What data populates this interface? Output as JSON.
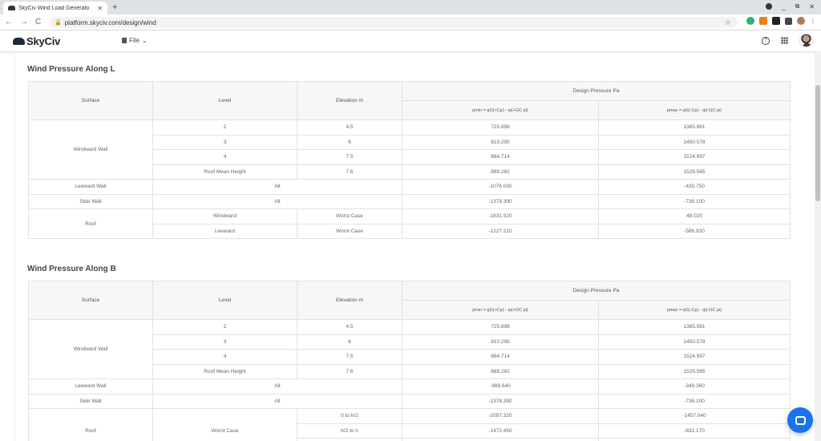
{
  "browser": {
    "tab_title": "SkyCiv Wind Load Generato",
    "tab_close": "✕",
    "new_tab": "+",
    "url": "platform.skyciv.com/design/wind",
    "win_minimize": "_",
    "win_restore": "⧉",
    "win_close": "✕",
    "back_glyph": "←",
    "forward_glyph": "→",
    "reload_glyph": "C",
    "star_glyph": "☆",
    "lock_glyph": "🔒"
  },
  "app": {
    "logo_text": "SkyCiv",
    "file_menu": "File",
    "file_chevron": "⌄",
    "help_glyph": "?"
  },
  "sections": [
    {
      "title": "Wind Pressure Along L",
      "headers": {
        "surface": "Surface",
        "level": "Level",
        "elevation": "Elevation m",
        "design_pressure": "Design Pressure Pa",
        "pmin": "pmin = qG(+Cp) - qi(+GC pi)",
        "pmax": "pmax = qG(-Cp) - qi(-GC pi)"
      },
      "windward_wall": {
        "label": "Windward Wall",
        "rows": [
          {
            "level": "2",
            "elev": "4.5",
            "pmin": "725.698",
            "pmax": "1365.981"
          },
          {
            "level": "3",
            "elev": "6",
            "pmin": "810.295",
            "pmax": "1450.578"
          },
          {
            "level": "4",
            "elev": "7.5",
            "pmin": "884.714",
            "pmax": "1524.997"
          },
          {
            "level": "Roof Mean Height",
            "elev": "7.6",
            "pmin": "889.282",
            "pmax": "1529.565"
          }
        ]
      },
      "leeward_wall": {
        "label": "Leeward Wall",
        "level": "All",
        "pmin": "-1076.030",
        "pmax": "-435.750"
      },
      "side_wall": {
        "label": "Side Wall",
        "level": "All",
        "pmin": "-1378.390",
        "pmax": "-738.100"
      },
      "roof": {
        "label": "Roof",
        "rows": [
          {
            "level": "Windward",
            "elev": "Worst Case",
            "pmin": "-1831.920",
            "pmax": "48.020"
          },
          {
            "level": "Leeward",
            "elev": "Worst Case",
            "pmin": "-1227.210",
            "pmax": "-586.930"
          }
        ]
      }
    },
    {
      "title": "Wind Pressure Along B",
      "headers": {
        "surface": "Surface",
        "level": "Level",
        "elevation": "Elevation m",
        "design_pressure": "Design Pressure Pa",
        "pmin": "pmin = qG(+Cp) - qi(+GC pi)",
        "pmax": "pmax = qG(-Cp) - qi(-GC pi)"
      },
      "windward_wall": {
        "label": "Windward Wall",
        "rows": [
          {
            "level": "2",
            "elev": "4.5",
            "pmin": "725.698",
            "pmax": "1365.981"
          },
          {
            "level": "3",
            "elev": "6",
            "pmin": "810.295",
            "pmax": "1450.578"
          },
          {
            "level": "4",
            "elev": "7.5",
            "pmin": "884.714",
            "pmax": "1524.997"
          },
          {
            "level": "Roof Mean Height",
            "elev": "7.6",
            "pmin": "889.282",
            "pmax": "1529.565"
          }
        ]
      },
      "leeward_wall": {
        "label": "Leeward Wall",
        "level": "All",
        "pmin": "-989.640",
        "pmax": "-349.360"
      },
      "side_wall": {
        "label": "Side Wall",
        "level": "All",
        "pmin": "-1378.390",
        "pmax": "-738.100"
      },
      "roof": {
        "label": "Roof",
        "level": "Worst Case",
        "rows": [
          {
            "elev": "0 to h/2",
            "pmin": "-2097.320",
            "pmax": "-1457.040"
          },
          {
            "elev": "h/2 to h",
            "pmin": "-1472.450",
            "pmax": "-832.170"
          }
        ]
      }
    }
  ]
}
